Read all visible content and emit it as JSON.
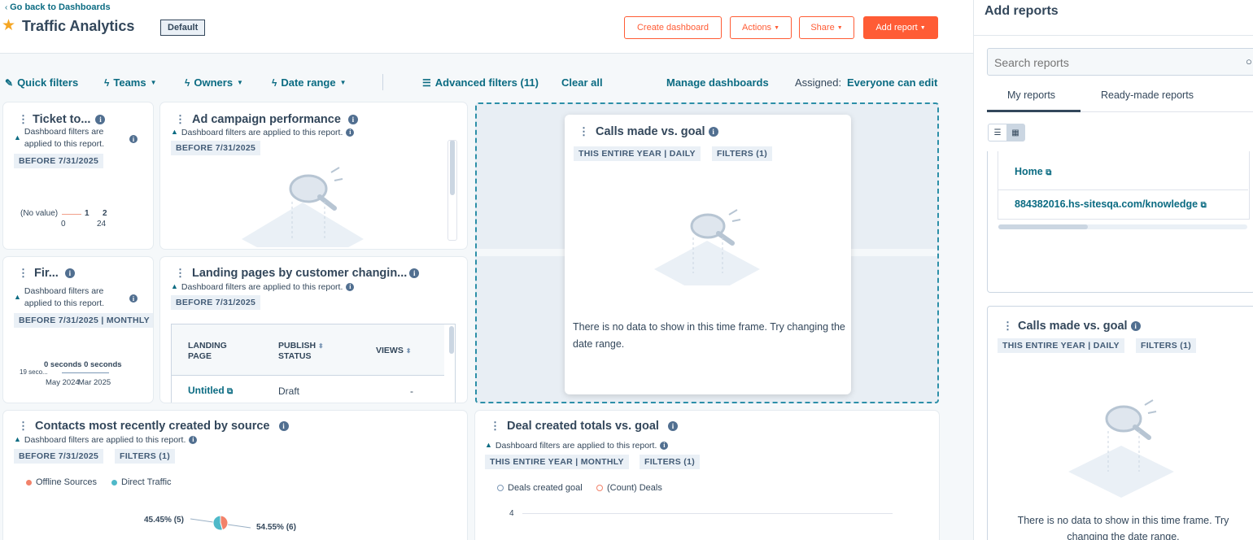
{
  "header": {
    "back_label": "Go back to Dashboards",
    "title": "Traffic Analytics",
    "default_badge": "Default",
    "buttons": {
      "create": "Create dashboard",
      "actions": "Actions",
      "share": "Share",
      "add_report": "Add report"
    }
  },
  "filters": {
    "quick": "Quick filters",
    "teams": "Teams",
    "owners": "Owners",
    "date_range": "Date range",
    "advanced": "Advanced filters (11)",
    "clear_all": "Clear all",
    "manage": "Manage dashboards",
    "assigned_label": "Assigned:",
    "assigned_value": "Everyone can edit"
  },
  "common": {
    "filters_applied": "Dashboard filters are applied to this report.",
    "filters_applied_wrap1": "Dashboard filters are",
    "filters_applied_wrap2": "applied to this report.",
    "no_data": "There is no data to show in this time frame. Try changing the date range.",
    "no_data_line1": "There is no data to show in this time frame. Try",
    "no_data_line2": "changing the date range."
  },
  "cards": {
    "ticket": {
      "title": "Ticket to...",
      "tag": "BEFORE 7/31/2025",
      "legend_none": "(No value)",
      "legend_s1": "1",
      "legend_s2": "2",
      "tick0": "0",
      "tick1": "24"
    },
    "ad": {
      "title": "Ad campaign performance",
      "tag": "BEFORE 7/31/2025"
    },
    "calls": {
      "title": "Calls made vs. goal",
      "tag1": "THIS ENTIRE YEAR | DAILY",
      "tag2": "FILTERS (1)"
    },
    "fir": {
      "title": "Fir...",
      "tag": "BEFORE 7/31/2025 | MONTHLY",
      "value": "0 seconds 0 seconds",
      "axis_label": "19 seco...",
      "x0": "May 2024",
      "x1": "Mar 2025"
    },
    "landing": {
      "title": "Landing pages by customer changin...",
      "tag": "BEFORE 7/31/2025",
      "col1a": "LANDING",
      "col1b": "PAGE",
      "col2a": "PUBLISH",
      "col2b": "STATUS",
      "col3": "VIEWS",
      "row_name": "Untitled",
      "row_status": "Draft",
      "row_views": "-"
    },
    "contacts": {
      "title": "Contacts most recently created by source",
      "tag1": "BEFORE 7/31/2025",
      "tag2": "FILTERS (1)",
      "legend1": "Offline Sources",
      "legend2": "Direct Traffic",
      "label1": "45.45% (5)",
      "label2": "54.55% (6)"
    },
    "deal": {
      "title": "Deal created totals vs. goal",
      "tag1": "THIS ENTIRE YEAR | MONTHLY",
      "tag2": "FILTERS (1)",
      "legend1": "Deals created goal",
      "legend2": "(Count) Deals",
      "y_tick": "4"
    }
  },
  "panel": {
    "title": "Add reports",
    "search_placeholder": "Search reports",
    "tab_my": "My reports",
    "tab_ready": "Ready-made reports",
    "list": [
      "Home",
      "884382016.hs-sitesqa.com/knowledge"
    ],
    "preview": {
      "title": "Calls made vs. goal",
      "tag1": "THIS ENTIRE YEAR | DAILY",
      "tag2": "FILTERS (1)"
    }
  },
  "chart_data": [
    {
      "type": "pie",
      "categories": [
        "Offline Sources",
        "Direct Traffic"
      ],
      "values": [
        5,
        6
      ],
      "labels": [
        "45.45% (5)",
        "54.55% (6)"
      ],
      "colors": [
        "#f2826a",
        "#4fb9c9"
      ]
    }
  ],
  "colors": {
    "accent": "#ff5c35",
    "link": "#0b6b82",
    "text": "#33475b"
  }
}
